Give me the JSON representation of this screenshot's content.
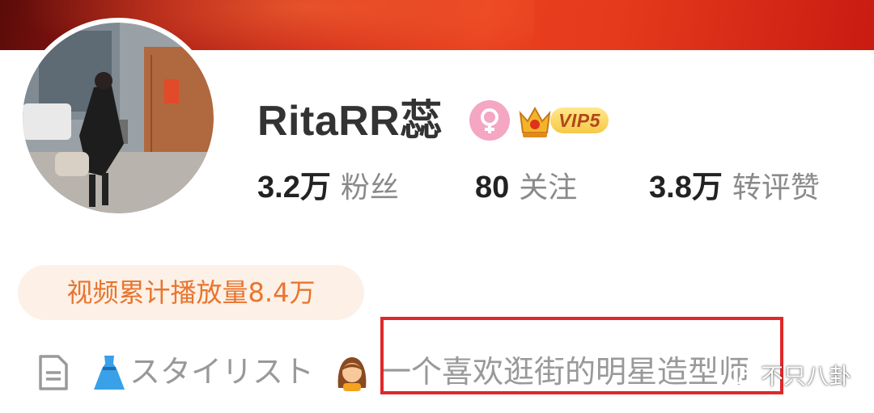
{
  "profile": {
    "username": "RitaRR蕊",
    "vip_label": "VIP5",
    "stats": [
      {
        "value": "3.2万",
        "label": "粉丝"
      },
      {
        "value": "80",
        "label": "关注"
      },
      {
        "value": "3.8万",
        "label": "转评赞"
      }
    ],
    "play_count": "视频累计播放量8.4万",
    "bio_jp": "スタイリスト",
    "bio_cn": "一个喜欢逛街的明星造型师"
  },
  "watermark": {
    "text": "不只八卦"
  },
  "colors": {
    "banner": "#d42a18",
    "pill_bg": "#fdf0e6",
    "pill_text": "#e8752e",
    "highlight": "#e0282a",
    "gender_badge": "#f4a6c2"
  },
  "icons": [
    "female-icon",
    "crown-icon",
    "document-icon",
    "dress-icon",
    "woman-emoji-icon",
    "wechat-logo-icon"
  ]
}
